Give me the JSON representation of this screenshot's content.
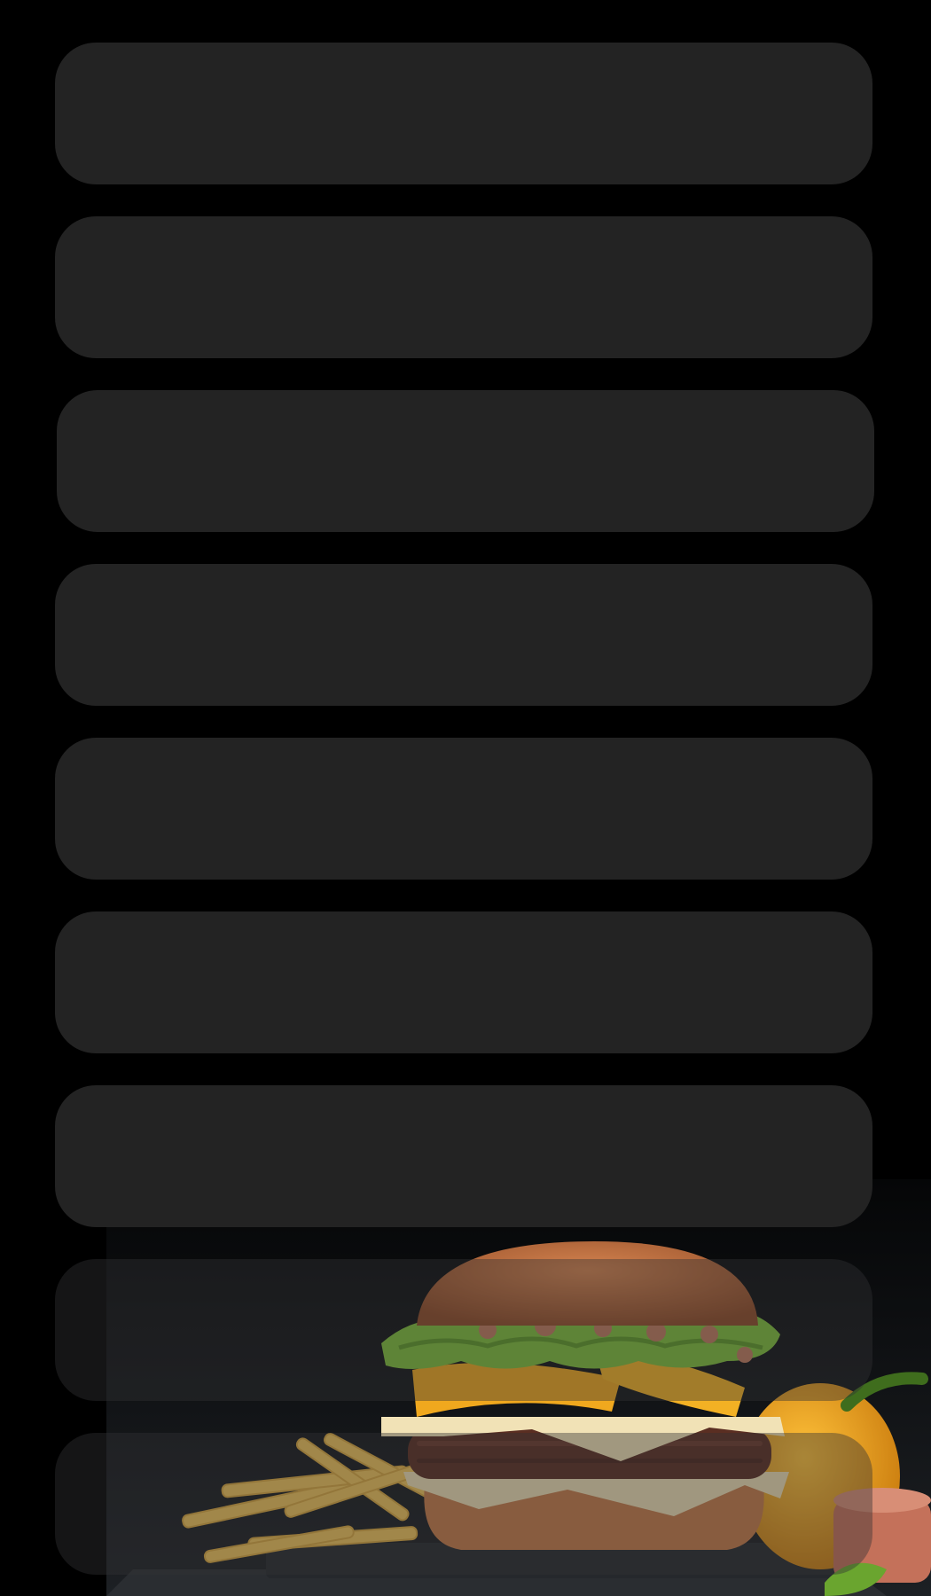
{
  "colors": {
    "background": "#000000",
    "card": "#242424",
    "bun": "#b9683a",
    "lettuce": "#7fbf3a",
    "cheese": "#efe0b5",
    "pepper": "#f0a81e",
    "patty": "#5a2e22",
    "fries": "#f3c95a",
    "slate": "#2a2d31"
  },
  "cards": [
    {
      "label": ""
    },
    {
      "label": ""
    },
    {
      "label": ""
    },
    {
      "label": ""
    },
    {
      "label": ""
    },
    {
      "label": ""
    },
    {
      "label": ""
    },
    {
      "label": ""
    },
    {
      "label": ""
    }
  ],
  "promo": {
    "icons": [
      "burger-image",
      "fries-image",
      "yellow-pepper-image",
      "sauce-dip-image"
    ]
  }
}
